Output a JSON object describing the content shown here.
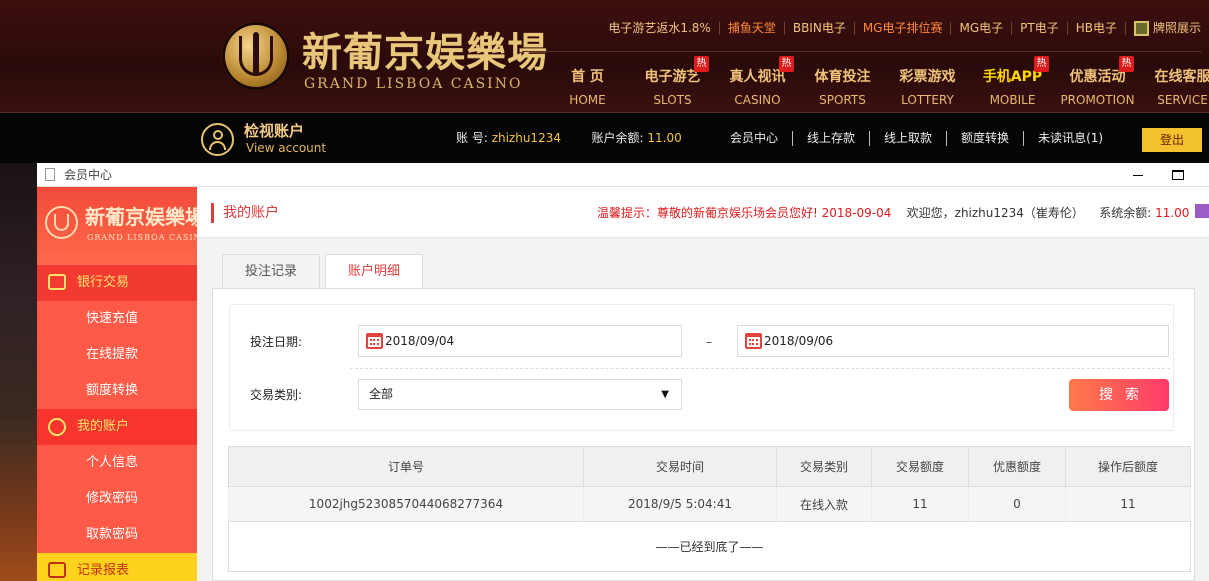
{
  "header": {
    "logo_cn": "新葡京娱樂場",
    "logo_en": "GRAND LISBOA CASINO",
    "top_links": [
      "电子游艺返水1.8%",
      "捕鱼天堂",
      "BBIN电子",
      "MG电子排位赛",
      "MG电子",
      "PT电子",
      "HB电子",
      "牌照展示"
    ],
    "nav": [
      {
        "cn": "首 页",
        "en": "HOME",
        "hot": ""
      },
      {
        "cn": "电子游艺",
        "en": "SLOTS",
        "hot": "热"
      },
      {
        "cn": "真人视讯",
        "en": "CASINO",
        "hot": "热"
      },
      {
        "cn": "体育投注",
        "en": "SPORTS",
        "hot": ""
      },
      {
        "cn": "彩票游戏",
        "en": "LOTTERY",
        "hot": ""
      },
      {
        "cn": "手机APP",
        "en": "MOBILE",
        "hot": "热"
      },
      {
        "cn": "优惠活动",
        "en": "PROMOTION",
        "hot": "热"
      },
      {
        "cn": "在线客服",
        "en": "SERVICE",
        "hot": ""
      }
    ]
  },
  "account_bar": {
    "title": "检视账户",
    "subtitle": "View account",
    "account_label": "账 号:",
    "account_value": "zhizhu1234",
    "balance_label": "账户余额:",
    "balance_value": "11.00",
    "menu": [
      "会员中心",
      "线上存款",
      "线上取款",
      "额度转换",
      "未读讯息(1)"
    ],
    "logout": "登出"
  },
  "window": {
    "title": "会员中心"
  },
  "sidebar": {
    "logo_cn": "新葡京娱樂場",
    "logo_en": "GRAND LISBOA CASINO",
    "groups": [
      {
        "label": "银行交易",
        "items": [
          "快速充值",
          "在线提款",
          "额度转换"
        ]
      },
      {
        "label": "我的账户",
        "items": [
          "个人信息",
          "修改密码",
          "取款密码"
        ]
      },
      {
        "label": "记录报表",
        "items": []
      }
    ]
  },
  "main": {
    "title": "我的账户",
    "notice": "温馨提示：尊敬的新葡京娱乐场会员您好! 2018-09-04",
    "welcome": "欢迎您，zhizhu1234（崔寿伦）",
    "balance_label": "系统余额:",
    "balance_value": "11.00",
    "tabs": [
      "投注记录",
      "账户明细"
    ],
    "form": {
      "date_label": "投注日期:",
      "date_from": "2018/09/04",
      "date_sep": "–",
      "date_to": "2018/09/06",
      "type_label": "交易类别:",
      "type_value": "全部",
      "search": "搜索"
    },
    "table": {
      "headers": [
        "订单号",
        "交易时间",
        "交易类别",
        "交易额度",
        "优惠额度",
        "操作后额度"
      ],
      "rows": [
        [
          "1002jhg5230857044068277364",
          "2018/9/5 5:04:41",
          "在线入款",
          "11",
          "0",
          "11"
        ]
      ],
      "end": "——已经到底了——"
    }
  },
  "colors": {
    "accent": "#e03a3a",
    "sidebar": "#fe5a47",
    "gold": "#f0c27a",
    "search_from": "#ff7a4a",
    "search_to": "#ff3a6a"
  }
}
